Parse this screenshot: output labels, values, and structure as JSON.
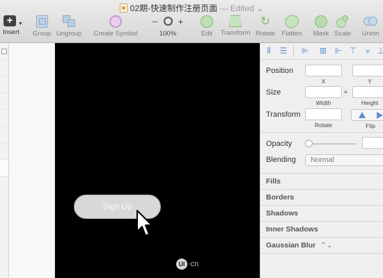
{
  "window": {
    "title": "02期-快速制作注册页面",
    "status": "— Edited",
    "dropdown_glyph": "⌄"
  },
  "toolbar": {
    "insert": "Insert",
    "group": "Group",
    "ungroup": "Ungroup",
    "create_symbol": "Create Symbol",
    "zoom_minus": "−",
    "zoom_plus": "+",
    "zoom_level": "100%",
    "edit": "Edit",
    "transform": "Transform",
    "rotate": "Rotate",
    "flatten": "Flatten",
    "mask": "Mask",
    "scale": "Scale",
    "union": "Union"
  },
  "canvas": {
    "button_label": "Sign Up",
    "watermark_badge": "UI",
    "watermark_text": "·cn"
  },
  "inspector": {
    "position_label": "Position",
    "x_label": "X",
    "y_label": "Y",
    "size_label": "Size",
    "width_label": "Width",
    "height_label": "Height",
    "transform_label": "Transform",
    "rotate_label": "Rotate",
    "flip_label": "Flip",
    "opacity_label": "Opacity",
    "opacity_value": 0,
    "blending_label": "Blending",
    "blending_value": "Normal",
    "sections": [
      "Fills",
      "Borders",
      "Shadows",
      "Inner Shadows",
      "Gaussian Blur"
    ],
    "gaussian_toggle": "⌃⌄"
  },
  "colors": {
    "canvas_bg": "#000000",
    "button_fill": "#d8d8d8",
    "accent": "#5d8fd0"
  }
}
